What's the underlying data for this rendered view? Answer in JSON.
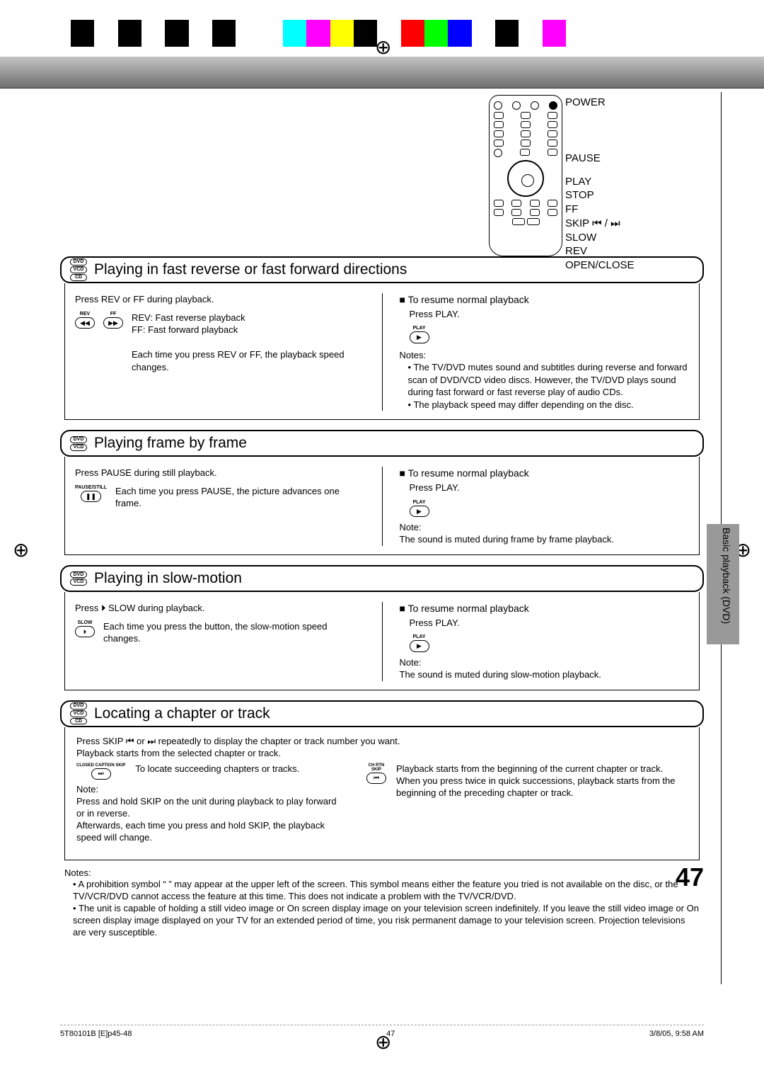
{
  "colorbar": [
    "black",
    "sp",
    "black",
    "sp",
    "black",
    "sp",
    "black",
    "sp",
    "sp",
    "cyan",
    "magenta",
    "yellow",
    "black",
    "sp",
    "red",
    "green",
    "blue",
    "sp",
    "black",
    "sp",
    "magenta"
  ],
  "remote_labels": {
    "power": "POWER",
    "pause": "PAUSE",
    "play": "PLAY",
    "stop": "STOP",
    "ff": "FF",
    "skip": "SKIP ⏮ / ⏭",
    "slow": "SLOW",
    "rev": "REV",
    "open": "OPEN/CLOSE"
  },
  "sections": {
    "fastrev": {
      "discs": [
        "DVD",
        "VCD",
        "CD"
      ],
      "title": "Playing in fast reverse or fast forward directions",
      "left": {
        "instruction": "Press REV or FF during playback.",
        "btn1_label": "REV",
        "btn1_icon": "◀◀",
        "btn2_label": "FF",
        "btn2_icon": "▶▶",
        "line1": "REV:  Fast reverse playback",
        "line2": "FF:     Fast forward playback",
        "line3": "Each time you press REV or FF, the playback speed changes."
      },
      "right": {
        "heading": "To resume normal playback",
        "action": "Press PLAY.",
        "btn_label": "PLAY",
        "btn_icon": "▶",
        "notes_label": "Notes:",
        "note1": "The TV/DVD mutes sound and subtitles during reverse and forward scan of DVD/VCD video discs. However, the TV/DVD plays sound during fast forward or fast reverse play of audio CDs.",
        "note2": "The playback speed may differ depending on the disc."
      }
    },
    "frame": {
      "discs": [
        "DVD",
        "VCD"
      ],
      "title": "Playing frame by frame",
      "left": {
        "instruction": "Press PAUSE during still playback.",
        "btn_label": "PAUSE/STILL",
        "btn_icon": "❚❚",
        "line1": "Each time you press PAUSE, the picture advances one frame."
      },
      "right": {
        "heading": "To resume normal playback",
        "action": "Press PLAY.",
        "btn_label": "PLAY",
        "btn_icon": "▶",
        "note_label": "Note:",
        "note1": "The sound is muted during frame by frame playback."
      }
    },
    "slow": {
      "discs": [
        "DVD",
        "VCD"
      ],
      "title": "Playing in slow-motion",
      "left": {
        "instruction": "Press ⏵ SLOW during playback.",
        "btn_label": "SLOW",
        "btn_icon": "⏵",
        "line1": "Each time you press the button, the slow-motion speed changes."
      },
      "right": {
        "heading": "To resume normal playback",
        "action": "Press PLAY.",
        "btn_label": "PLAY",
        "btn_icon": "▶",
        "note_label": "Note:",
        "note1": "The sound is muted during slow-motion playback."
      }
    },
    "locate": {
      "discs": [
        "DVD",
        "VCD",
        "CD"
      ],
      "title": "Locating a chapter or track",
      "instruction": "Press SKIP ⏮ or ⏭ repeatedly to display the chapter or track number you want.",
      "line2": "Playback starts from the selected chapter or track.",
      "btnL_label": "CLOSED CAPTION SKIP",
      "btnL_icon": "⏭",
      "btnL_text": "To locate succeeding chapters or tracks.",
      "btnR_label": "CH RTN SKIP",
      "btnR_icon": "⏮",
      "btnR_text1": "Playback starts from the beginning of the current chapter or track.",
      "btnR_text2": "When you press twice in quick successions, playback starts from the beginning of the preceding chapter or track.",
      "note_label": "Note:",
      "note_line1": "Press and hold SKIP on the unit during playback to play forward or in reverse.",
      "note_line2": "Afterwards, each time you press and hold SKIP, the playback speed will change."
    }
  },
  "bottom_notes": {
    "label": "Notes:",
    "n1": "A prohibition symbol “     ” may appear at the upper left of the screen. This symbol means either the feature you tried is not available on the disc, or the TV/VCR/DVD cannot access the feature at this time. This does not indicate a problem with the TV/VCR/DVD.",
    "n2": "The unit is capable of holding a still video image or On screen display image on your television screen indefinitely. If you leave the still video image or On screen display image displayed on your TV for an extended period of time, you risk permanent damage to your television screen. Projection televisions are very susceptible."
  },
  "side_tab": "Basic playback (DVD)",
  "page_number": "47",
  "footer": {
    "file": "5T80101B [E]p45-48",
    "pg": "47",
    "date": "3/8/05, 9:58 AM"
  }
}
